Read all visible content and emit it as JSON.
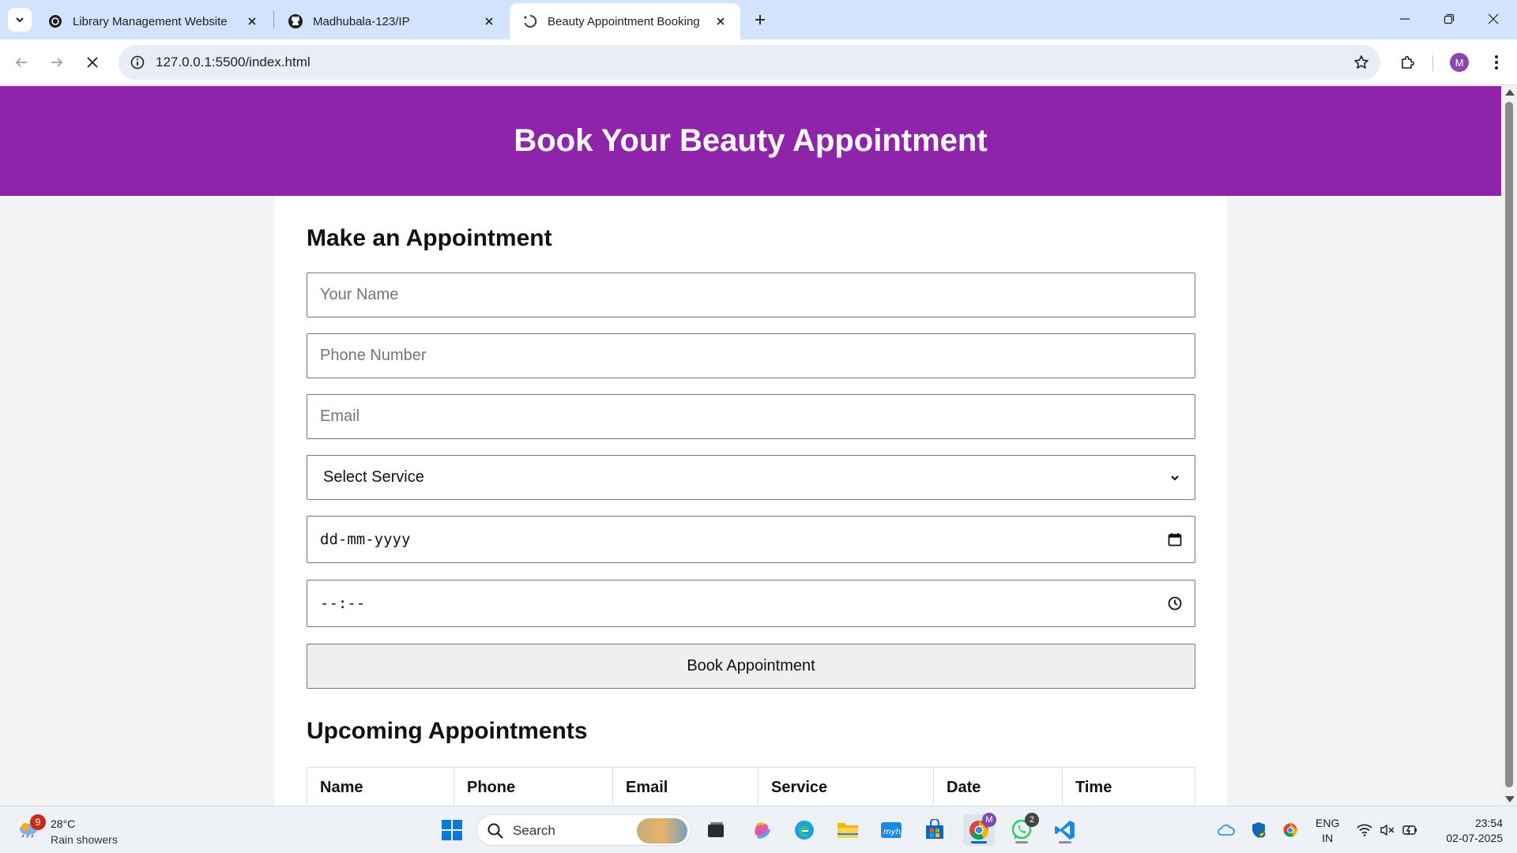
{
  "browser": {
    "tabs": [
      {
        "title": "Library Management Website",
        "icon": "openai-icon"
      },
      {
        "title": "Madhubala-123/IP",
        "icon": "github-icon"
      },
      {
        "title": "Beauty Appointment Booking",
        "icon": "loading-icon"
      }
    ],
    "active_tab_index": 2,
    "url": "127.0.0.1:5500/index.html",
    "profile_initial": "M"
  },
  "page": {
    "header_title": "Book Your Beauty Appointment",
    "form_title": "Make an Appointment",
    "fields": {
      "name_placeholder": "Your Name",
      "phone_placeholder": "Phone Number",
      "email_placeholder": "Email",
      "service_selected": "Select Service",
      "date_placeholder": "dd-mm-yyyy",
      "time_placeholder": "--:--"
    },
    "submit_label": "Book Appointment",
    "list_title": "Upcoming Appointments",
    "table_headers": [
      "Name",
      "Phone",
      "Email",
      "Service",
      "Date",
      "Time"
    ],
    "accent_color": "#8e24aa"
  },
  "taskbar": {
    "weather": {
      "badge": "9",
      "temp": "28°C",
      "condition": "Rain showers"
    },
    "search_label": "Search",
    "whatsapp_badge": "2",
    "chrome_badge": "M",
    "lang_top": "ENG",
    "lang_bottom": "IN",
    "time": "23:54",
    "date": "02-07-2025"
  }
}
